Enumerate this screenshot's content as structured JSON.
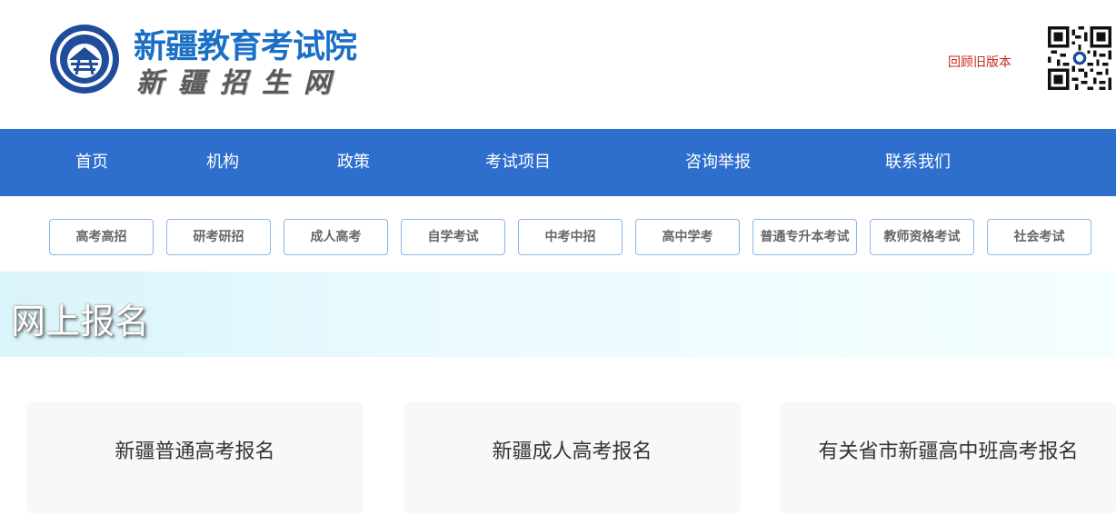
{
  "header": {
    "title": "新疆教育考试院",
    "subtitle": "新疆招生网",
    "old_version_link": "回顾旧版本",
    "emblem_icon": "exam-institute-emblem-icon",
    "qr_icon": "qr-code-icon"
  },
  "nav": {
    "items": [
      {
        "label": "首页"
      },
      {
        "label": "机构"
      },
      {
        "label": "政策"
      },
      {
        "label": "考试项目"
      },
      {
        "label": "咨询举报"
      },
      {
        "label": "联系我们"
      }
    ],
    "background": "#2e6fce"
  },
  "subnav": {
    "items": [
      {
        "label": "高考高招"
      },
      {
        "label": "研考研招"
      },
      {
        "label": "成人高考"
      },
      {
        "label": "自学考试"
      },
      {
        "label": "中考中招"
      },
      {
        "label": "高中学考"
      },
      {
        "label": "普通专升本考试"
      },
      {
        "label": "教师资格考试"
      },
      {
        "label": "社会考试"
      }
    ]
  },
  "banner": {
    "title": "网上报名"
  },
  "cards": [
    {
      "label": "新疆普通高考报名"
    },
    {
      "label": "新疆成人高考报名"
    },
    {
      "label": "有关省市新疆高中班高考报名"
    }
  ],
  "colors": {
    "brand_blue": "#1c6fc6",
    "link_red": "#c62a1e"
  }
}
